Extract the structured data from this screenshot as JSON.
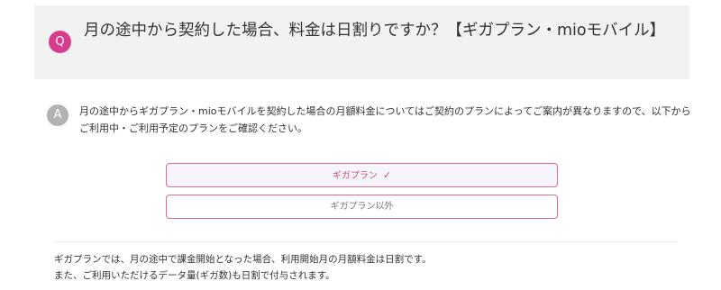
{
  "question": {
    "badge": "Q",
    "title": "月の途中から契約した場合、料金は日割りですか？【ギガプラン・mioモバイル】"
  },
  "answer": {
    "badge": "A",
    "intro": "月の途中からギガプラン・mioモバイルを契約した場合の月額料金についてはご契約のプランによってご案内が異なりますので、以下からご利用中・ご利用予定のプランをご確認ください。"
  },
  "plan_tabs": [
    {
      "label": "ギガプラン",
      "selected": true,
      "check": "✓"
    },
    {
      "label": "ギガプラン以外",
      "selected": false
    }
  ],
  "detail": {
    "line1": "ギガプランでは、月の途中で課金開始となった場合、利用開始月の月額料金は日割です。",
    "line2": "また、ご利用いただけるデータ量(ギガ数)も日割で付与されます。"
  },
  "colors": {
    "accent": "#d63d8e",
    "answer_badge": "#b3b3b3",
    "question_bg": "#f2f2f2"
  }
}
